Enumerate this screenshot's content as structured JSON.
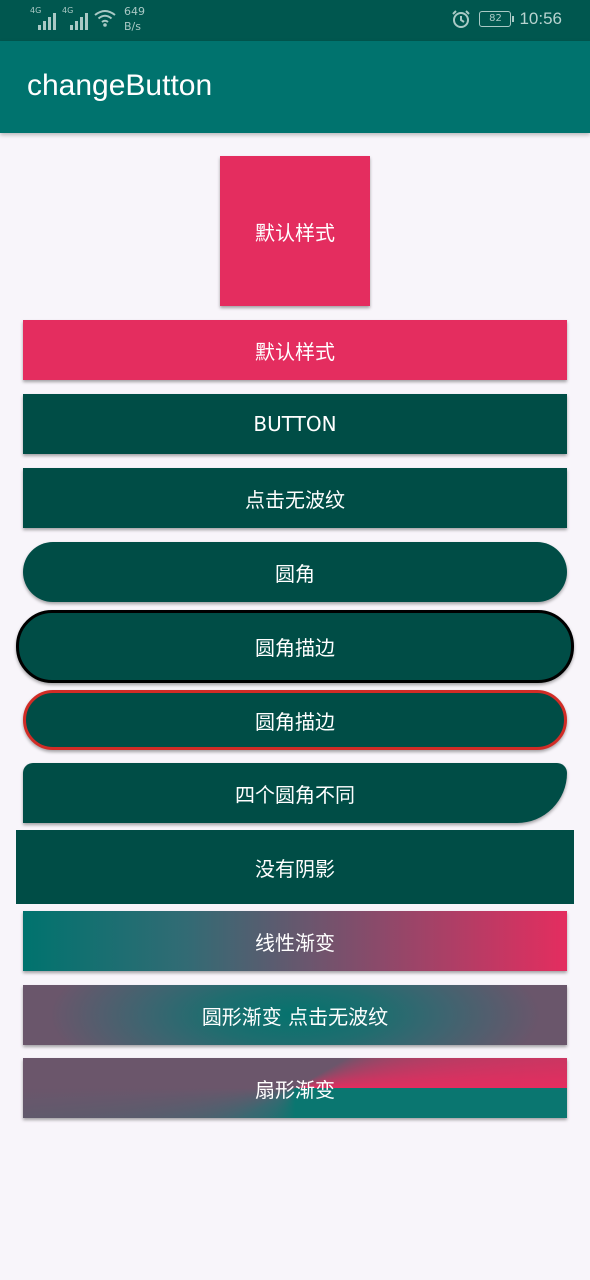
{
  "status_bar": {
    "signal1_label": "4G",
    "signal2_label": "4G",
    "net_rate_value": "649",
    "net_rate_unit": "B/s",
    "battery": "82",
    "time": "10:56",
    "icons": [
      "signal-icon",
      "signal-icon",
      "wifi-icon",
      "alarm-icon",
      "battery-icon"
    ]
  },
  "app_bar": {
    "title": "changeButton"
  },
  "buttons": [
    {
      "id": "b1",
      "label": "默认样式"
    },
    {
      "id": "b2",
      "label": "默认样式"
    },
    {
      "id": "b3",
      "label": "BUTTON"
    },
    {
      "id": "b4",
      "label": "点击无波纹"
    },
    {
      "id": "b5",
      "label": "圆角"
    },
    {
      "id": "b6",
      "label": "圆角描边"
    },
    {
      "id": "b7",
      "label": "圆角描边"
    },
    {
      "id": "b8",
      "label": "四个圆角不同"
    },
    {
      "id": "b9",
      "label": "没有阴影"
    },
    {
      "id": "b10",
      "label": "线性渐变"
    },
    {
      "id": "b11",
      "label": "圆形渐变 点击无波纹"
    },
    {
      "id": "b12",
      "label": "扇形渐变"
    }
  ],
  "colors": {
    "status_bar_bg": "#00574f",
    "app_bar_bg": "#00736e",
    "primary_dark": "#004d46",
    "accent_pink": "#e42d5f",
    "stroke_black": "#000000",
    "stroke_red": "#d12c26",
    "background": "#f8f5fa"
  }
}
